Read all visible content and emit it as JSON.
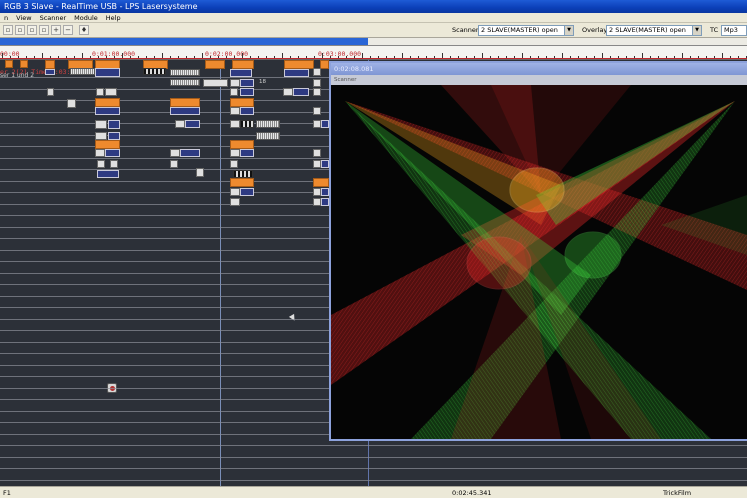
{
  "window": {
    "title": "RGB 3 Slave - RealTime USB - LPS Lasersysteme"
  },
  "menu": [
    "n",
    "View",
    "Scanner",
    "Module",
    "Help"
  ],
  "toolbar": {
    "scanner_label": "Scanner",
    "scanner_value": "2 SLAVE(MASTER) open",
    "overlay_label": "Overlay",
    "overlay_value": "2 SLAVE(MASTER) open",
    "tc_label": "TC",
    "tc_value": "Mp3"
  },
  "ruler": {
    "labels": [
      "00:00",
      "0:01:00.000",
      "0:02:00.000",
      "0:03:00.000"
    ]
  },
  "timeline": {
    "info": "er 2(2) Time 0:03:27.000",
    "track_name": "ser 1 und 2",
    "block_label": "18"
  },
  "scanner_window": {
    "title": "0:02:08.081",
    "subtitle": "Scanner"
  },
  "status": {
    "left": "F1",
    "time": "0:02:45.341",
    "right": "TrickFilm"
  },
  "colors": {
    "laser_red": "#ff2a2a",
    "laser_green": "#3ee03e",
    "laser_yellow": "#ffb020",
    "block_orange": "#ee8a2e",
    "block_purple": "#2e3a82"
  }
}
